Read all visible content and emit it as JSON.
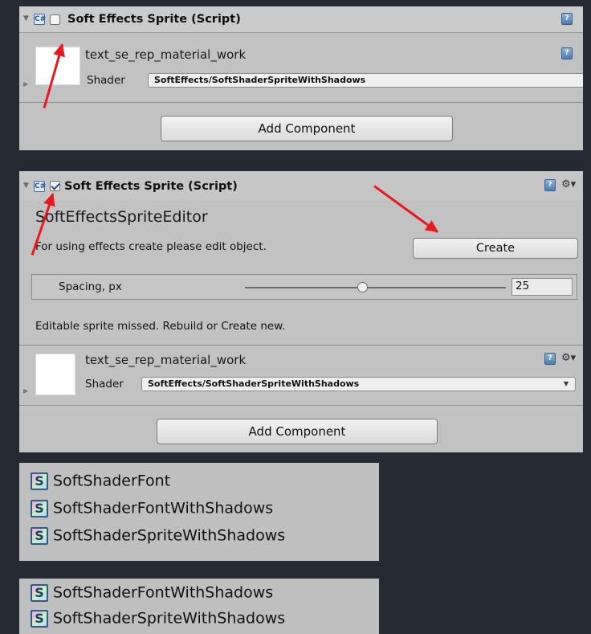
{
  "panel1": {
    "component_title": "Soft Effects Sprite (Script)",
    "material_name": "text_se_rep_material_work",
    "shader_label": "Shader",
    "shader_value": "SoftEffects/SoftShaderSpriteWithShadows",
    "add_component_label": "Add Component",
    "enabled": false
  },
  "panel2": {
    "component_title": "Soft Effects Sprite (Script)",
    "enabled": true,
    "editor_title": "SoftEffectsSpriteEditor",
    "info_text": "For using effects create please edit object.",
    "create_label": "Create",
    "spacing_label": "Spacing, px",
    "spacing_value": "25",
    "spacing_fraction": 0.45,
    "missing_text": "Editable sprite missed. Rebuild or Create new.",
    "material_name": "text_se_rep_material_work",
    "shader_label": "Shader",
    "shader_value": "SoftEffects/SoftShaderSpriteWithShadows",
    "add_component_label": "Add Component"
  },
  "list1": {
    "items": [
      {
        "icon": "S",
        "label": "SoftShaderFont"
      },
      {
        "icon": "S",
        "label": "SoftShaderFontWithShadows"
      },
      {
        "icon": "S",
        "label": "SoftShaderSpriteWithShadows"
      }
    ]
  },
  "list2": {
    "items": [
      {
        "icon": "S",
        "label": "SoftShaderFontWithShadows"
      },
      {
        "icon": "S",
        "label": "SoftShaderSpriteWithShadows"
      }
    ]
  },
  "colors": {
    "background": "#252a33",
    "panel": "#c2c2c2",
    "annotation_arrow": "#e8191d",
    "checkbox_check": "#1f4fa0"
  }
}
